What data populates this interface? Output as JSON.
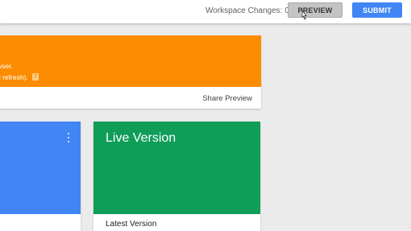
{
  "topbar": {
    "workspace_changes_label": "Workspace Changes:",
    "workspace_changes_count": "0",
    "preview_label": "PREVIEW",
    "submit_label": "SUBMIT"
  },
  "preview_card": {
    "line1": "wser.",
    "line2": "d refresh).",
    "help_icon": "?",
    "share_preview_label": "Share Preview"
  },
  "live_card": {
    "title": "Live Version",
    "subtitle": "Latest Version"
  },
  "colors": {
    "orange": "#fb8c00",
    "blue": "#4285f4",
    "green": "#0f9d58",
    "submit": "#4285f4",
    "preview_button": "#c4c4c4"
  },
  "icons": [
    "help-icon",
    "kebab-menu-icon",
    "mouse-cursor-icon"
  ]
}
